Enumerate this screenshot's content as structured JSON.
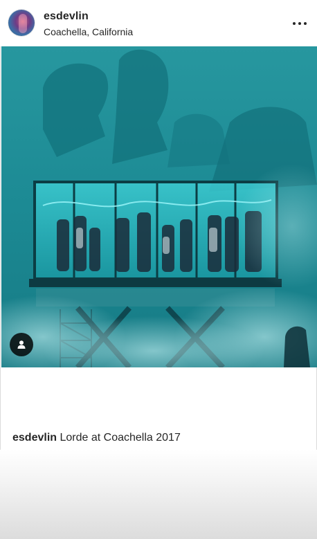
{
  "post": {
    "username": "esdevlin",
    "location": "Coachella, California",
    "more_icon": "more-horizontal-icon",
    "tag_icon": "user-tag-icon"
  },
  "caption": {
    "username": "esdevlin",
    "text": "Lorde at Coachella 2017"
  },
  "colors": {
    "photo_teal": "#1f8e97",
    "text": "#262626"
  }
}
